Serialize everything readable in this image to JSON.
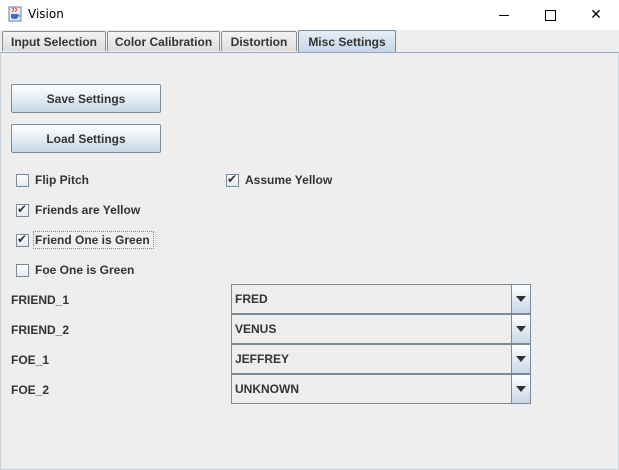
{
  "window": {
    "title": "Vision",
    "minimize_glyph": "",
    "close_glyph": "✕"
  },
  "tabs": [
    {
      "label": "Input Selection",
      "active": false
    },
    {
      "label": "Color Calibration",
      "active": false
    },
    {
      "label": "Distortion",
      "active": false
    },
    {
      "label": "Misc Settings",
      "active": true
    }
  ],
  "buttons": {
    "save": "Save Settings",
    "load": "Load Settings"
  },
  "checkboxes": [
    {
      "label": "Flip Pitch",
      "checked": false
    },
    {
      "label": "Assume Yellow",
      "checked": true
    },
    {
      "label": "Friends are Yellow",
      "checked": true
    },
    {
      "label": "Friend One is Green",
      "checked": true,
      "focused": true
    },
    {
      "label": "Foe One is Green",
      "checked": false
    }
  ],
  "check_glyph": "✔",
  "robots": [
    {
      "label": "FRIEND_1",
      "value": "FRED"
    },
    {
      "label": "FRIEND_2",
      "value": "VENUS"
    },
    {
      "label": "FOE_1",
      "value": "JEFFREY"
    },
    {
      "label": "FOE_2",
      "value": "UNKNOWN"
    }
  ],
  "icons": {
    "app": "java-cup-icon",
    "minimize": "minimize-icon",
    "maximize": "maximize-icon",
    "close": "close-icon",
    "dropdown": "chevron-down-icon"
  }
}
